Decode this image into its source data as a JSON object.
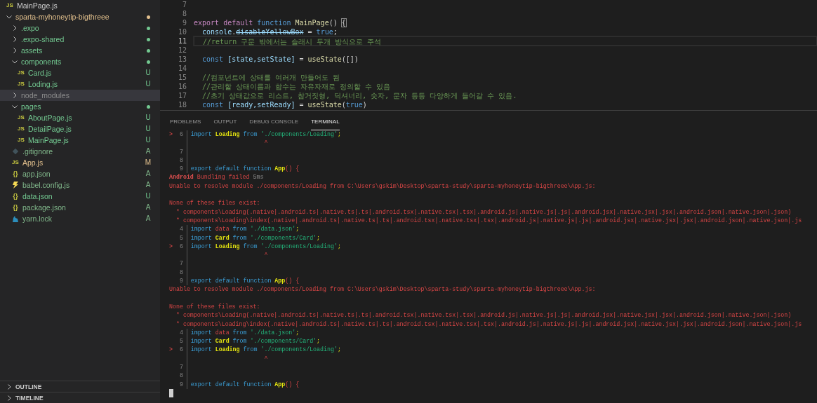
{
  "explorer": {
    "items": [
      {
        "name": "MainPage.js",
        "kind": "js",
        "icon": "JS",
        "color": "#cccccc",
        "selected": false
      },
      {
        "name": "sparta-myhoneytip-bigthreee",
        "kind": "folder",
        "color": "#e2c08d",
        "dot": true,
        "expanded": true,
        "selected": false,
        "children": [
          {
            "name": ".expo",
            "kind": "folder",
            "color": "#73c991",
            "dot": true,
            "expanded": false,
            "selected": false
          },
          {
            "name": ".expo-shared",
            "kind": "folder",
            "color": "#73c991",
            "dot": true,
            "expanded": false,
            "selected": false
          },
          {
            "name": "assets",
            "kind": "folder",
            "color": "#73c991",
            "dot": true,
            "expanded": false,
            "selected": false
          },
          {
            "name": "components",
            "kind": "folder",
            "color": "#73c991",
            "dot": true,
            "expanded": true,
            "selected": false,
            "children": [
              {
                "name": "Card.js",
                "kind": "js",
                "icon": "JS",
                "color": "#73c991",
                "badge": "U",
                "selected": false
              },
              {
                "name": "Loding.js",
                "kind": "js",
                "icon": "JS",
                "color": "#73c991",
                "badge": "U",
                "selected": false
              }
            ]
          },
          {
            "name": "node_modules",
            "kind": "folder",
            "color": "#8c8c8c",
            "expanded": false,
            "selected": true
          },
          {
            "name": "pages",
            "kind": "folder",
            "color": "#73c991",
            "dot": true,
            "expanded": true,
            "selected": false,
            "children": [
              {
                "name": "AboutPage.js",
                "kind": "js",
                "icon": "JS",
                "color": "#73c991",
                "badge": "U",
                "selected": false
              },
              {
                "name": "DetailPage.js",
                "kind": "js",
                "icon": "JS",
                "color": "#73c991",
                "badge": "U",
                "selected": false
              },
              {
                "name": "MainPage.js",
                "kind": "js",
                "icon": "JS",
                "color": "#73c991",
                "badge": "U",
                "selected": false
              }
            ]
          },
          {
            "name": ".gitignore",
            "kind": "git",
            "color": "#81b88b",
            "badge": "A",
            "selected": false
          },
          {
            "name": "App.js",
            "kind": "js",
            "icon": "JS",
            "color": "#e2c08d",
            "badge": "M",
            "selected": false
          },
          {
            "name": "app.json",
            "kind": "json",
            "icon": "{}",
            "color": "#81b88b",
            "badge": "A",
            "selected": false
          },
          {
            "name": "babel.config.js",
            "kind": "babel",
            "color": "#81b88b",
            "badge": "A",
            "selected": false
          },
          {
            "name": "data.json",
            "kind": "json",
            "icon": "{}",
            "color": "#73c991",
            "badge": "U",
            "selected": false
          },
          {
            "name": "package.json",
            "kind": "json",
            "icon": "{}",
            "color": "#81b88b",
            "badge": "A",
            "selected": false
          },
          {
            "name": "yarn.lock",
            "kind": "yarn",
            "color": "#81b88b",
            "badge": "A",
            "selected": false
          }
        ]
      }
    ],
    "sections": [
      {
        "label": "OUTLINE",
        "expanded": false
      },
      {
        "label": "TIMELINE",
        "expanded": false
      }
    ]
  },
  "editor": {
    "lines": [
      {
        "num": "7",
        "current": false
      },
      {
        "num": "8",
        "current": false
      },
      {
        "num": "9",
        "current": false,
        "tokens": [
          {
            "kind": "ctrl",
            "text": "export default "
          },
          {
            "kind": "kw",
            "text": "function "
          },
          {
            "kind": "fn",
            "text": "MainPage"
          },
          {
            "kind": "plain",
            "text": "() "
          },
          {
            "kind": "match",
            "text": "{"
          }
        ]
      },
      {
        "num": "10",
        "current": false,
        "tokens": [
          {
            "kind": "var",
            "text": "  console"
          },
          {
            "kind": "plain",
            "text": "."
          },
          {
            "kind": "strike",
            "text": "disableYellowBox"
          },
          {
            "kind": "plain",
            "text": " = "
          },
          {
            "kind": "kw",
            "text": "true"
          },
          {
            "kind": "plain",
            "text": ";"
          }
        ]
      },
      {
        "num": "11",
        "current": true,
        "tokens": [
          {
            "kind": "comment",
            "text": "  //return 구문 밖에서는 슬래시 두개 방식으로 주석"
          }
        ]
      },
      {
        "num": "12",
        "current": false
      },
      {
        "num": "13",
        "current": false,
        "tokens": [
          {
            "kind": "kw",
            "text": "  const "
          },
          {
            "kind": "var",
            "text": "[state,setState]"
          },
          {
            "kind": "plain",
            "text": " = "
          },
          {
            "kind": "fn",
            "text": "useState"
          },
          {
            "kind": "plain",
            "text": "([])"
          }
        ]
      },
      {
        "num": "14",
        "current": false
      },
      {
        "num": "15",
        "current": false,
        "tokens": [
          {
            "kind": "comment",
            "text": "  //컴포넌트에 상태를 여러개 만들어도 됨"
          }
        ]
      },
      {
        "num": "16",
        "current": false,
        "tokens": [
          {
            "kind": "comment",
            "text": "  //관리할 상태이름과 함수는 자유자재로 정의할 수 있음"
          }
        ]
      },
      {
        "num": "17",
        "current": false,
        "tokens": [
          {
            "kind": "comment",
            "text": "  //초기 상태값으로 리스트, 참거짓형, 딕셔너리, 숫자, 문자 등등 다양하게 들어갈 수 있음."
          }
        ]
      },
      {
        "num": "18",
        "current": false,
        "tokens": [
          {
            "kind": "kw",
            "text": "  const "
          },
          {
            "kind": "var",
            "text": "[ready,setReady]"
          },
          {
            "kind": "plain",
            "text": " = "
          },
          {
            "kind": "fn",
            "text": "useState"
          },
          {
            "kind": "plain",
            "text": "("
          },
          {
            "kind": "kw",
            "text": "true"
          },
          {
            "kind": "plain",
            "text": ")"
          }
        ]
      }
    ]
  },
  "panel": {
    "tabs": [
      {
        "label": "PROBLEMS",
        "selected": false
      },
      {
        "label": "OUTPUT",
        "selected": false
      },
      {
        "label": "DEBUG CONSOLE",
        "selected": false
      },
      {
        "label": "TERMINAL",
        "selected": true
      }
    ],
    "terminal": [
      {
        "kind": "code",
        "marker": ">",
        "num": "6",
        "tokens": [
          {
            "kind": "t-kw",
            "text": "import "
          },
          {
            "kind": "t-name",
            "text": "Loading"
          },
          {
            "kind": "t-kw",
            "text": " from "
          },
          {
            "kind": "t-str",
            "text": "'./components/Loading'"
          },
          {
            "kind": "t-punct",
            "text": ";"
          }
        ]
      },
      {
        "kind": "caret",
        "tokens": [
          {
            "kind": "t-red",
            "text": "                     ^"
          }
        ]
      },
      {
        "kind": "code",
        "num": "7"
      },
      {
        "kind": "code",
        "num": "8"
      },
      {
        "kind": "code",
        "num": "9",
        "tokens": [
          {
            "kind": "t-kw",
            "text": "export default function "
          },
          {
            "kind": "t-name",
            "text": "App"
          },
          {
            "kind": "t-red",
            "text": "() {"
          }
        ]
      },
      {
        "kind": "text",
        "tokens": [
          {
            "kind": "t-redb",
            "text": "Android"
          },
          {
            "kind": "t-red",
            "text": " Bundling failed "
          },
          {
            "kind": "t-grey",
            "text": "5ms"
          }
        ]
      },
      {
        "kind": "text",
        "tokens": [
          {
            "kind": "t-red",
            "text": "Unable to resolve module ./components/Loading from C:\\Users\\gskim\\Desktop\\sparta-study\\sparta-myhoneytip-bigthreee\\App.js:"
          }
        ]
      },
      {
        "kind": "text"
      },
      {
        "kind": "text",
        "tokens": [
          {
            "kind": "t-red",
            "text": "None of these files exist:"
          }
        ]
      },
      {
        "kind": "text",
        "tokens": [
          {
            "kind": "t-red",
            "text": "  * components\\Loading(.native|.android.ts|.native.ts|.ts|.android.tsx|.native.tsx|.tsx|.android.js|.native.js|.js|.android.jsx|.native.jsx|.jsx|.android.json|.native.json|.json)"
          }
        ]
      },
      {
        "kind": "text",
        "tokens": [
          {
            "kind": "t-red",
            "text": "  * components\\Loading\\index(.native|.android.ts|.native.ts|.ts|.android.tsx|.native.tsx|.tsx|.android.js|.native.js|.js|.android.jsx|.native.jsx|.jsx|.android.json|.native.json|.js"
          }
        ]
      },
      {
        "kind": "code",
        "num": "4",
        "tokens": [
          {
            "kind": "t-kw",
            "text": "import "
          },
          {
            "kind": "t-red",
            "text": "data"
          },
          {
            "kind": "t-kw",
            "text": " from "
          },
          {
            "kind": "t-str",
            "text": "'./data.json'"
          },
          {
            "kind": "t-punct",
            "text": ";"
          }
        ]
      },
      {
        "kind": "code",
        "num": "5",
        "tokens": [
          {
            "kind": "t-kw",
            "text": "import "
          },
          {
            "kind": "t-name",
            "text": "Card"
          },
          {
            "kind": "t-kw",
            "text": " from "
          },
          {
            "kind": "t-str",
            "text": "'./components/Card'"
          },
          {
            "kind": "t-punct",
            "text": ";"
          }
        ]
      },
      {
        "kind": "code",
        "marker": ">",
        "num": "6",
        "tokens": [
          {
            "kind": "t-kw",
            "text": "import "
          },
          {
            "kind": "t-name",
            "text": "Loading"
          },
          {
            "kind": "t-kw",
            "text": " from "
          },
          {
            "kind": "t-str",
            "text": "'./components/Loading'"
          },
          {
            "kind": "t-punct",
            "text": ";"
          }
        ]
      },
      {
        "kind": "caret",
        "tokens": [
          {
            "kind": "t-red",
            "text": "                     ^"
          }
        ]
      },
      {
        "kind": "code",
        "num": "7"
      },
      {
        "kind": "code",
        "num": "8"
      },
      {
        "kind": "code",
        "num": "9",
        "tokens": [
          {
            "kind": "t-kw",
            "text": "export default function "
          },
          {
            "kind": "t-name",
            "text": "App"
          },
          {
            "kind": "t-red",
            "text": "() {"
          }
        ]
      },
      {
        "kind": "text",
        "tokens": [
          {
            "kind": "t-red",
            "text": "Unable to resolve module ./components/Loading from C:\\Users\\gskim\\Desktop\\sparta-study\\sparta-myhoneytip-bigthreee\\App.js:"
          }
        ]
      },
      {
        "kind": "text"
      },
      {
        "kind": "text",
        "tokens": [
          {
            "kind": "t-red",
            "text": "None of these files exist:"
          }
        ]
      },
      {
        "kind": "text",
        "tokens": [
          {
            "kind": "t-red",
            "text": "  * components\\Loading(.native|.android.ts|.native.ts|.ts|.android.tsx|.native.tsx|.tsx|.android.js|.native.js|.js|.android.jsx|.native.jsx|.jsx|.android.json|.native.json|.json)"
          }
        ]
      },
      {
        "kind": "text",
        "tokens": [
          {
            "kind": "t-red",
            "text": "  * components\\Loading\\index(.native|.android.ts|.native.ts|.ts|.android.tsx|.native.tsx|.tsx|.android.js|.native.js|.js|.android.jsx|.native.jsx|.jsx|.android.json|.native.json|.js"
          }
        ]
      },
      {
        "kind": "code",
        "num": "4",
        "tokens": [
          {
            "kind": "t-kw",
            "text": "import "
          },
          {
            "kind": "t-red",
            "text": "data"
          },
          {
            "kind": "t-kw",
            "text": " from "
          },
          {
            "kind": "t-str",
            "text": "'./data.json'"
          },
          {
            "kind": "t-punct",
            "text": ";"
          }
        ]
      },
      {
        "kind": "code",
        "num": "5",
        "tokens": [
          {
            "kind": "t-kw",
            "text": "import "
          },
          {
            "kind": "t-name",
            "text": "Card"
          },
          {
            "kind": "t-kw",
            "text": " from "
          },
          {
            "kind": "t-str",
            "text": "'./components/Card'"
          },
          {
            "kind": "t-punct",
            "text": ";"
          }
        ]
      },
      {
        "kind": "code",
        "marker": ">",
        "num": "6",
        "tokens": [
          {
            "kind": "t-kw",
            "text": "import "
          },
          {
            "kind": "t-name",
            "text": "Loading"
          },
          {
            "kind": "t-kw",
            "text": " from "
          },
          {
            "kind": "t-str",
            "text": "'./components/Loading'"
          },
          {
            "kind": "t-punct",
            "text": ";"
          }
        ]
      },
      {
        "kind": "caret",
        "tokens": [
          {
            "kind": "t-red",
            "text": "                     ^"
          }
        ]
      },
      {
        "kind": "code",
        "num": "7"
      },
      {
        "kind": "code",
        "num": "8"
      },
      {
        "kind": "code",
        "num": "9",
        "tokens": [
          {
            "kind": "t-kw",
            "text": "export default function "
          },
          {
            "kind": "t-name",
            "text": "App"
          },
          {
            "kind": "t-red",
            "text": "() {"
          }
        ]
      },
      {
        "kind": "cursor"
      }
    ]
  }
}
